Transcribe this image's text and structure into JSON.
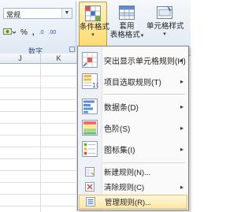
{
  "ribbon": {
    "number_format": "常规",
    "currency_symbol": "%",
    "comma_symbol": ",",
    "decrease_decimal": ".00",
    "increase_decimal": ".0",
    "number_group_label": "数字",
    "conditional_formatting": {
      "line1": "条件格式",
      "arrow": "▾"
    },
    "format_as_table": {
      "line1": "套用",
      "line2": "表格格式",
      "arrow": "▾"
    },
    "cell_styles": {
      "line1": "单元格样式",
      "arrow": "▾"
    }
  },
  "sheet": {
    "columns": [
      "J",
      "K"
    ]
  },
  "menu": {
    "items": [
      {
        "label": "突出显示单元格规则(H)",
        "icon": "highlight-cells-icon",
        "submenu": "▸"
      },
      {
        "label": "项目选取规则(T)",
        "icon": "top-bottom-rules-icon",
        "submenu": "▸"
      },
      {
        "label": "数据条(D)",
        "icon": "data-bars-icon",
        "submenu": "▸"
      },
      {
        "label": "色阶(S)",
        "icon": "color-scales-icon",
        "submenu": "▸"
      },
      {
        "label": "图标集(I)",
        "icon": "icon-sets-icon",
        "submenu": "▸"
      },
      {
        "label": "新建规则(N)...",
        "icon": "new-rule-icon"
      },
      {
        "label": "清除规则(C)",
        "icon": "clear-rules-icon",
        "submenu": "▸"
      },
      {
        "label": "管理规则(R)...",
        "icon": "manage-rules-icon"
      }
    ],
    "highlight_color": "#ffe8a6"
  }
}
